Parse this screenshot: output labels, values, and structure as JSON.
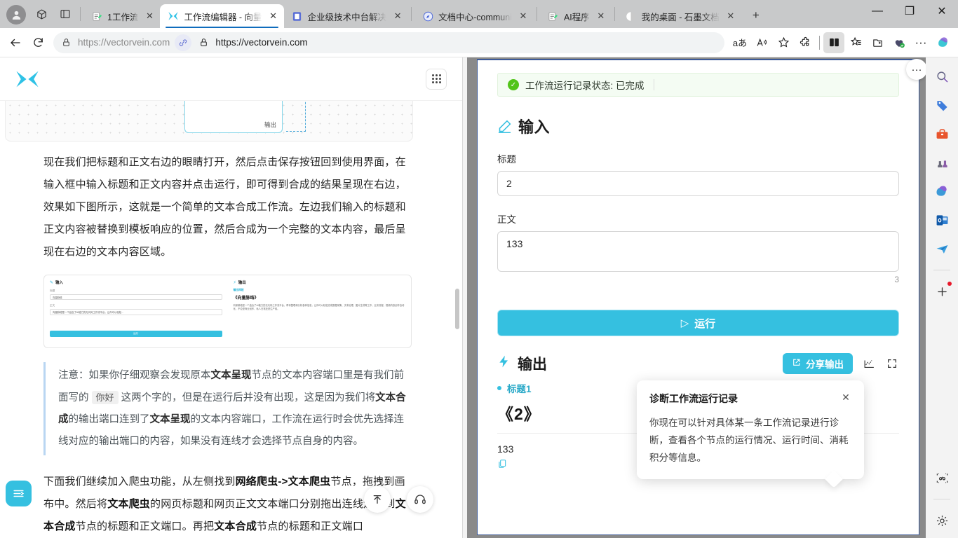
{
  "browser": {
    "tabs": [
      {
        "title": "1工作流",
        "favicon": "sheets-icon",
        "active": false
      },
      {
        "title": "工作流编辑器 - 向量",
        "favicon": "vectorvein-x-icon",
        "active": true
      },
      {
        "title": "企业级技术中台解决",
        "favicon": "doc-blue-icon",
        "active": false
      },
      {
        "title": "文档中心-communi",
        "favicon": "compass-icon",
        "active": false
      },
      {
        "title": "AI程序",
        "favicon": "sheets-icon",
        "active": false
      },
      {
        "title": "我的桌面 - 石墨文档",
        "favicon": "moon-icon",
        "active": false
      }
    ],
    "new_tab_label": "+",
    "close_label": "✕",
    "window_controls": {
      "minimize": "—",
      "maximize": "❐",
      "close": "✕"
    },
    "address": {
      "url_secondary": "https://vectorvein.com",
      "url_primary": "https://vectorvein.com"
    },
    "nav": {
      "back": "back-icon",
      "reload": "reload-icon"
    },
    "toolbar_right": [
      "translate-icon",
      "read-aloud-icon",
      "favorite-icon",
      "extensions-icon",
      "split-screen-icon",
      "collections-icon",
      "add-collection-icon",
      "shopping-icon",
      "more-icon",
      "copilot-icon"
    ]
  },
  "left_pane": {
    "site_logo": "vectorvein-x-logo",
    "grid_menu": "apps-grid-icon",
    "canvas": {
      "port_label": "输出"
    },
    "paragraph1": "现在我们把标题和正文右边的眼睛打开，然后点击保存按钮回到使用界面，在输入框中输入标题和正文内容并点击运行，即可得到合成的结果呈现在右边，效果如下图所示，这就是一个简单的文本合成工作流。左边我们输入的标题和正文内容被替换到模板响应的位置，然后合成为一个完整的文本内容，最后呈现在右边的文本内容区域。",
    "screenshot": {
      "input_title": "输入",
      "label_title": "标题",
      "value_title": "向量脉络",
      "label_body": "正文",
      "value_body": "向量脉络是一个结合了AI能力的无代码工作流平台，让你可以轻松...",
      "run_label": "运行",
      "output_title": "输出",
      "bullet": "输出样板",
      "heading": "《向量脉络》",
      "body": "向量脉络是一个结合了AI能力的无代码工作流平台，帮你整理和分析各种信息，让你可以轻松完成数据采集、文本处理、图片生成等工作，业务流程、视频内容创作自动化，不论是商业创作、私人日常还是生产线。"
    },
    "note": {
      "prefix": "注意：如果你仔细观察会发现原本",
      "bold1": "文本呈现",
      "mid1": "节点的文本内容端口里是有我们前面写的",
      "code": "你好",
      "mid2": "这两个字的，但是在运行后并没有出现，这是因为我们将",
      "bold2": "文本合成",
      "mid3": "的输出端口连到了",
      "bold3": "文本呈现",
      "mid4": "的文本内容端口，工作流在运行时会优先选择连线对应的输出端口的内容，如果没有连线才会选择节点自身的内容。"
    },
    "paragraph2": {
      "p1": "下面我们继续加入爬虫功能，从左侧找到",
      "b1": "网络爬虫->文本爬虫",
      "p2": "节点，拖拽到画布中。然后将",
      "b2": "文本爬虫",
      "p3": "的网页标题和网页正文文本端口分别拖出连线连接到",
      "b3": "文本合成",
      "p4": "节点的标题和正文端口。再把",
      "b4": "文本合成",
      "p5": "节点的标题和正文端口"
    },
    "fab_menu": "sidebar-toggle-icon",
    "fab_top": "scroll-to-top-icon",
    "fab_support": "headphones-support-icon"
  },
  "right_pane": {
    "split_controls": {
      "more": "···",
      "close": "✕"
    },
    "status": {
      "icon": "check-circle-icon",
      "text": "工作流运行记录状态: 已完成"
    },
    "input_section": {
      "icon": "edit-pencil-icon",
      "title": "输入",
      "fields": [
        {
          "label": "标题",
          "value": "2",
          "type": "input"
        },
        {
          "label": "正文",
          "value": "133",
          "type": "textarea",
          "counter": "3"
        }
      ]
    },
    "run_button": {
      "icon": "play-icon",
      "label": "运行"
    },
    "output_section": {
      "icon": "lightning-icon",
      "title": "输出",
      "share_button": {
        "icon": "external-link-icon",
        "label": "分享输出"
      },
      "diagnose_icon": "diagnose-chart-icon",
      "fullscreen_icon": "fullscreen-icon",
      "bullet_label": "标题1",
      "heading": "《2》",
      "body": "133",
      "copy_icon": "copy-icon"
    },
    "tooltip": {
      "title": "诊断工作流运行记录",
      "close": "✕",
      "text": "你现在可以针对具体某一条工作流记录进行诊断，查看各个节点的运行情况、运行时间、消耗积分等信息。"
    }
  },
  "edge_sidebar": {
    "items": [
      {
        "name": "search-icon"
      },
      {
        "name": "shopping-tag-icon"
      },
      {
        "name": "toolbox-icon"
      },
      {
        "name": "games-icon"
      },
      {
        "name": "copilot-icon"
      },
      {
        "name": "outlook-icon"
      },
      {
        "name": "telegram-plane-icon"
      },
      {
        "name": "add-tool-icon",
        "badge": true
      },
      {
        "name": "screenshot-icon"
      },
      {
        "name": "settings-gear-icon"
      }
    ]
  },
  "colors": {
    "accent_cyan": "#35c0e0",
    "accent_blue": "#0f6cbd",
    "success_green": "#52c41a",
    "split_border": "#3b5998",
    "teal_tab": "#14708a"
  }
}
